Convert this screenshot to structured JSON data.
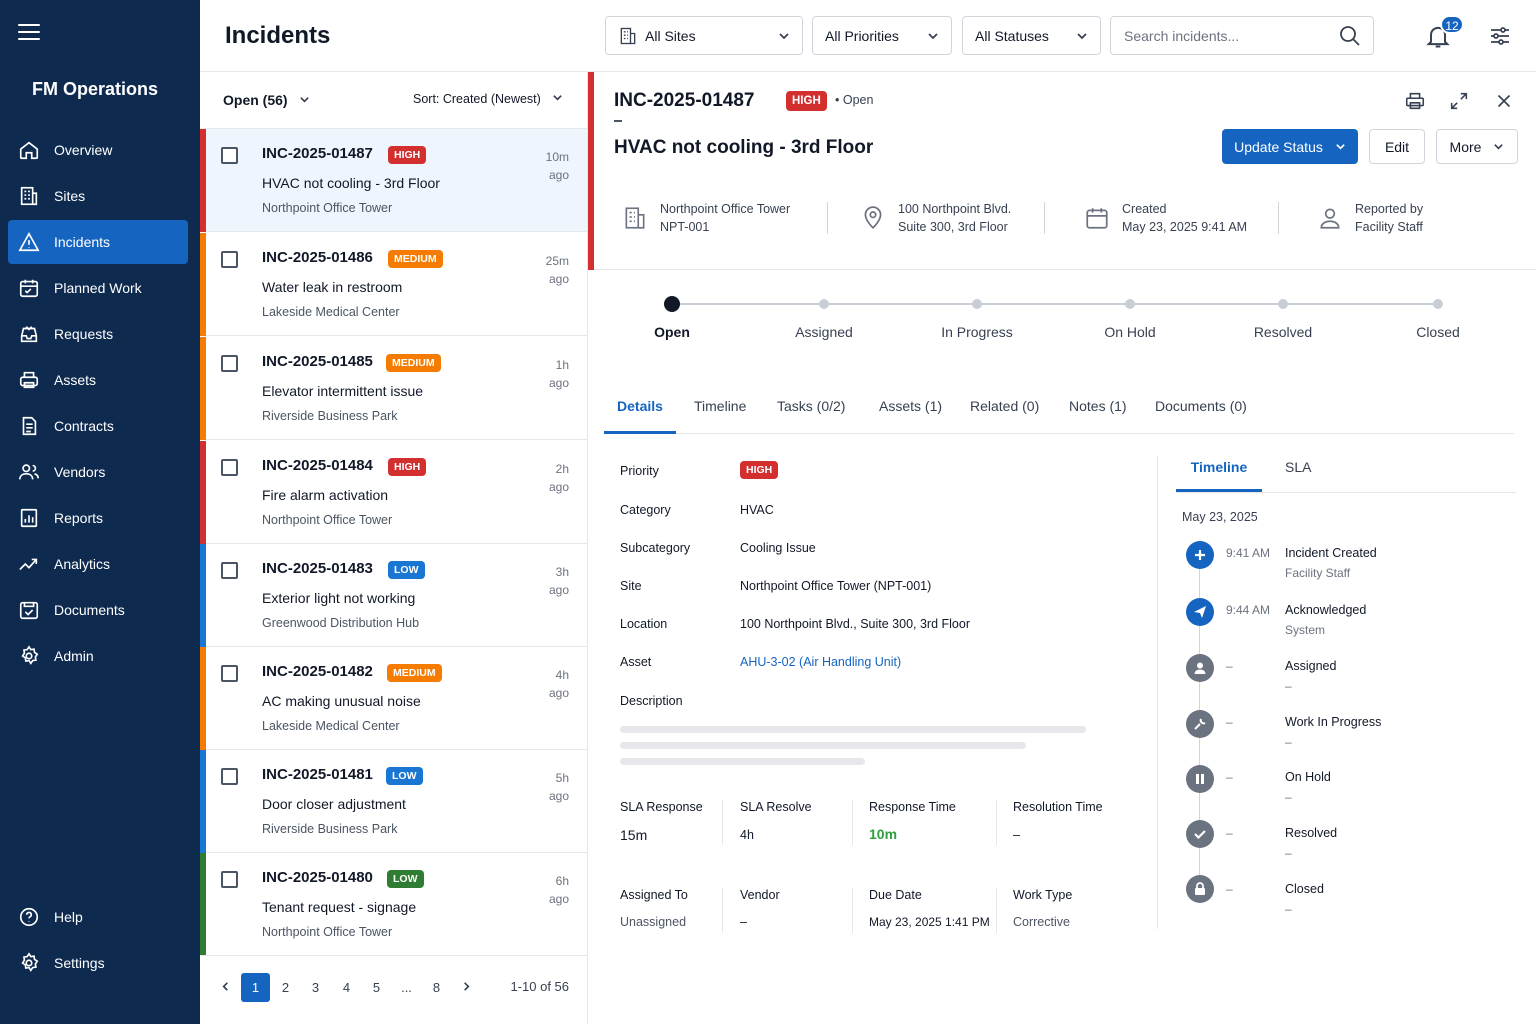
{
  "app": {
    "name": "FM Operations"
  },
  "colors": {
    "sidebar": "#0e2a4f",
    "accent": "#1565c0",
    "high": "#d32f2f",
    "medium": "#f57c00",
    "low_blue": "#1976d2",
    "low_green": "#2e7d32",
    "success": "#2e9e3e"
  },
  "nav": {
    "items": [
      {
        "label": "Overview",
        "icon": "home-icon"
      },
      {
        "label": "Sites",
        "icon": "building-icon"
      },
      {
        "label": "Incidents",
        "icon": "warning-icon",
        "active": true
      },
      {
        "label": "Planned Work",
        "icon": "calendar-icon"
      },
      {
        "label": "Requests",
        "icon": "inbox-icon"
      },
      {
        "label": "Assets",
        "icon": "printer-icon"
      },
      {
        "label": "Contracts",
        "icon": "document-icon"
      },
      {
        "label": "Vendors",
        "icon": "users-icon"
      },
      {
        "label": "Reports",
        "icon": "report-icon"
      },
      {
        "label": "Analytics",
        "icon": "trend-icon"
      },
      {
        "label": "Documents",
        "icon": "folder-icon"
      },
      {
        "label": "Admin",
        "icon": "gear-icon"
      }
    ],
    "bottom": [
      {
        "label": "Help",
        "icon": "help-icon"
      },
      {
        "label": "Settings",
        "icon": "gear-icon"
      }
    ]
  },
  "header": {
    "title": "Incidents",
    "filters": {
      "sites": "All Sites",
      "priorities": "All Priorities",
      "statuses": "All Statuses"
    },
    "search_placeholder": "Search incidents...",
    "notifications": "12"
  },
  "list": {
    "filter_label": "Open (56)",
    "sort_label": "Sort: Created (Newest)",
    "items": [
      {
        "id": "INC-2025-01487",
        "priority": "HIGH",
        "title": "HVAC not cooling - 3rd Floor",
        "site": "Northpoint Office Tower",
        "time": "10m",
        "ago": "ago",
        "color": "#d32f2f"
      },
      {
        "id": "INC-2025-01486",
        "priority": "MEDIUM",
        "title": "Water leak in restroom",
        "site": "Lakeside Medical Center",
        "time": "25m",
        "ago": "ago",
        "color": "#f57c00"
      },
      {
        "id": "INC-2025-01485",
        "priority": "MEDIUM",
        "title": "Elevator intermittent issue",
        "site": "Riverside Business Park",
        "time": "1h",
        "ago": "ago",
        "color": "#f57c00"
      },
      {
        "id": "INC-2025-01484",
        "priority": "HIGH",
        "title": "Fire alarm activation",
        "site": "Northpoint Office Tower",
        "time": "2h",
        "ago": "ago",
        "color": "#d32f2f"
      },
      {
        "id": "INC-2025-01483",
        "priority": "LOW",
        "title": "Exterior light not working",
        "site": "Greenwood Distribution Hub",
        "time": "3h",
        "ago": "ago",
        "color": "#1976d2"
      },
      {
        "id": "INC-2025-01482",
        "priority": "MEDIUM",
        "title": "AC making unusual noise",
        "site": "Lakeside Medical Center",
        "time": "4h",
        "ago": "ago",
        "color": "#f57c00"
      },
      {
        "id": "INC-2025-01481",
        "priority": "LOW",
        "title": "Door closer adjustment",
        "site": "Riverside Business Park",
        "time": "5h",
        "ago": "ago",
        "color": "#1976d2"
      },
      {
        "id": "INC-2025-01480",
        "priority": "LOW",
        "title": "Tenant request - signage",
        "site": "Northpoint Office Tower",
        "time": "6h",
        "ago": "ago",
        "color": "#2e7d32"
      }
    ],
    "pagination": {
      "pages": [
        "1",
        "2",
        "3",
        "4",
        "5",
        "...",
        "8"
      ],
      "current": "1",
      "count": "1-10 of 56"
    }
  },
  "detail": {
    "id": "INC-2025-01487",
    "priority": "HIGH",
    "status": "Open",
    "title": "HVAC not cooling - 3rd Floor",
    "buttons": {
      "update": "Update Status",
      "edit": "Edit",
      "more": "More"
    },
    "meta": {
      "site_name": "Northpoint Office Tower",
      "site_code": "NPT-001",
      "address1": "100 Northpoint Blvd.",
      "address2": "Suite 300, 3rd Floor",
      "created_label": "Created",
      "created_value": "May 23, 2025 9:41 AM",
      "reported_label": "Reported by",
      "reported_value": "Facility Staff"
    },
    "steps": [
      "Open",
      "Assigned",
      "In Progress",
      "On Hold",
      "Resolved",
      "Closed"
    ],
    "tabs": [
      "Details",
      "Timeline",
      "Tasks (0/2)",
      "Assets (1)",
      "Related (0)",
      "Notes (1)",
      "Documents (0)"
    ],
    "fields": {
      "priority_label": "Priority",
      "priority_value": "HIGH",
      "category_label": "Category",
      "category_value": "HVAC",
      "subcategory_label": "Subcategory",
      "subcategory_value": "Cooling Issue",
      "site_label": "Site",
      "site_value": "Northpoint Office Tower (NPT-001)",
      "location_label": "Location",
      "location_value": "100 Northpoint Blvd., Suite 300, 3rd Floor",
      "asset_label": "Asset",
      "asset_value": "AHU-3-02 (Air Handling Unit)",
      "description_label": "Description"
    },
    "sla": {
      "response_label": "SLA Response",
      "response_value": "15m",
      "resolve_label": "SLA Resolve",
      "resolve_value": "4h",
      "resp_time_label": "Response Time",
      "resp_time_value": "10m",
      "res_time_label": "Resolution Time",
      "res_time_value": "–"
    },
    "assign": {
      "assigned_label": "Assigned To",
      "assigned_value": "Unassigned",
      "vendor_label": "Vendor",
      "vendor_value": "–",
      "due_label": "Due Date",
      "due_value": "May 23, 2025 1:41 PM",
      "worktype_label": "Work Type",
      "worktype_value": "Corrective"
    },
    "right_tabs": [
      "Timeline",
      "SLA"
    ],
    "timeline_date": "May 23, 2025",
    "timeline": [
      {
        "time": "9:41 AM",
        "title": "Incident Created",
        "sub": "Facility Staff",
        "icon": "plus-icon",
        "state": "done"
      },
      {
        "time": "9:44 AM",
        "title": "Acknowledged",
        "sub": "System",
        "icon": "send-icon",
        "state": "done"
      },
      {
        "time": "–",
        "title": "Assigned",
        "sub": "–",
        "icon": "person-icon",
        "state": "pending"
      },
      {
        "time": "–",
        "title": "Work In Progress",
        "sub": "–",
        "icon": "wrench-icon",
        "state": "pending"
      },
      {
        "time": "–",
        "title": "On Hold",
        "sub": "–",
        "icon": "pause-icon",
        "state": "pending"
      },
      {
        "time": "–",
        "title": "Resolved",
        "sub": "–",
        "icon": "check-icon",
        "state": "pending"
      },
      {
        "time": "–",
        "title": "Closed",
        "sub": "–",
        "icon": "lock-icon",
        "state": "pending"
      }
    ]
  }
}
